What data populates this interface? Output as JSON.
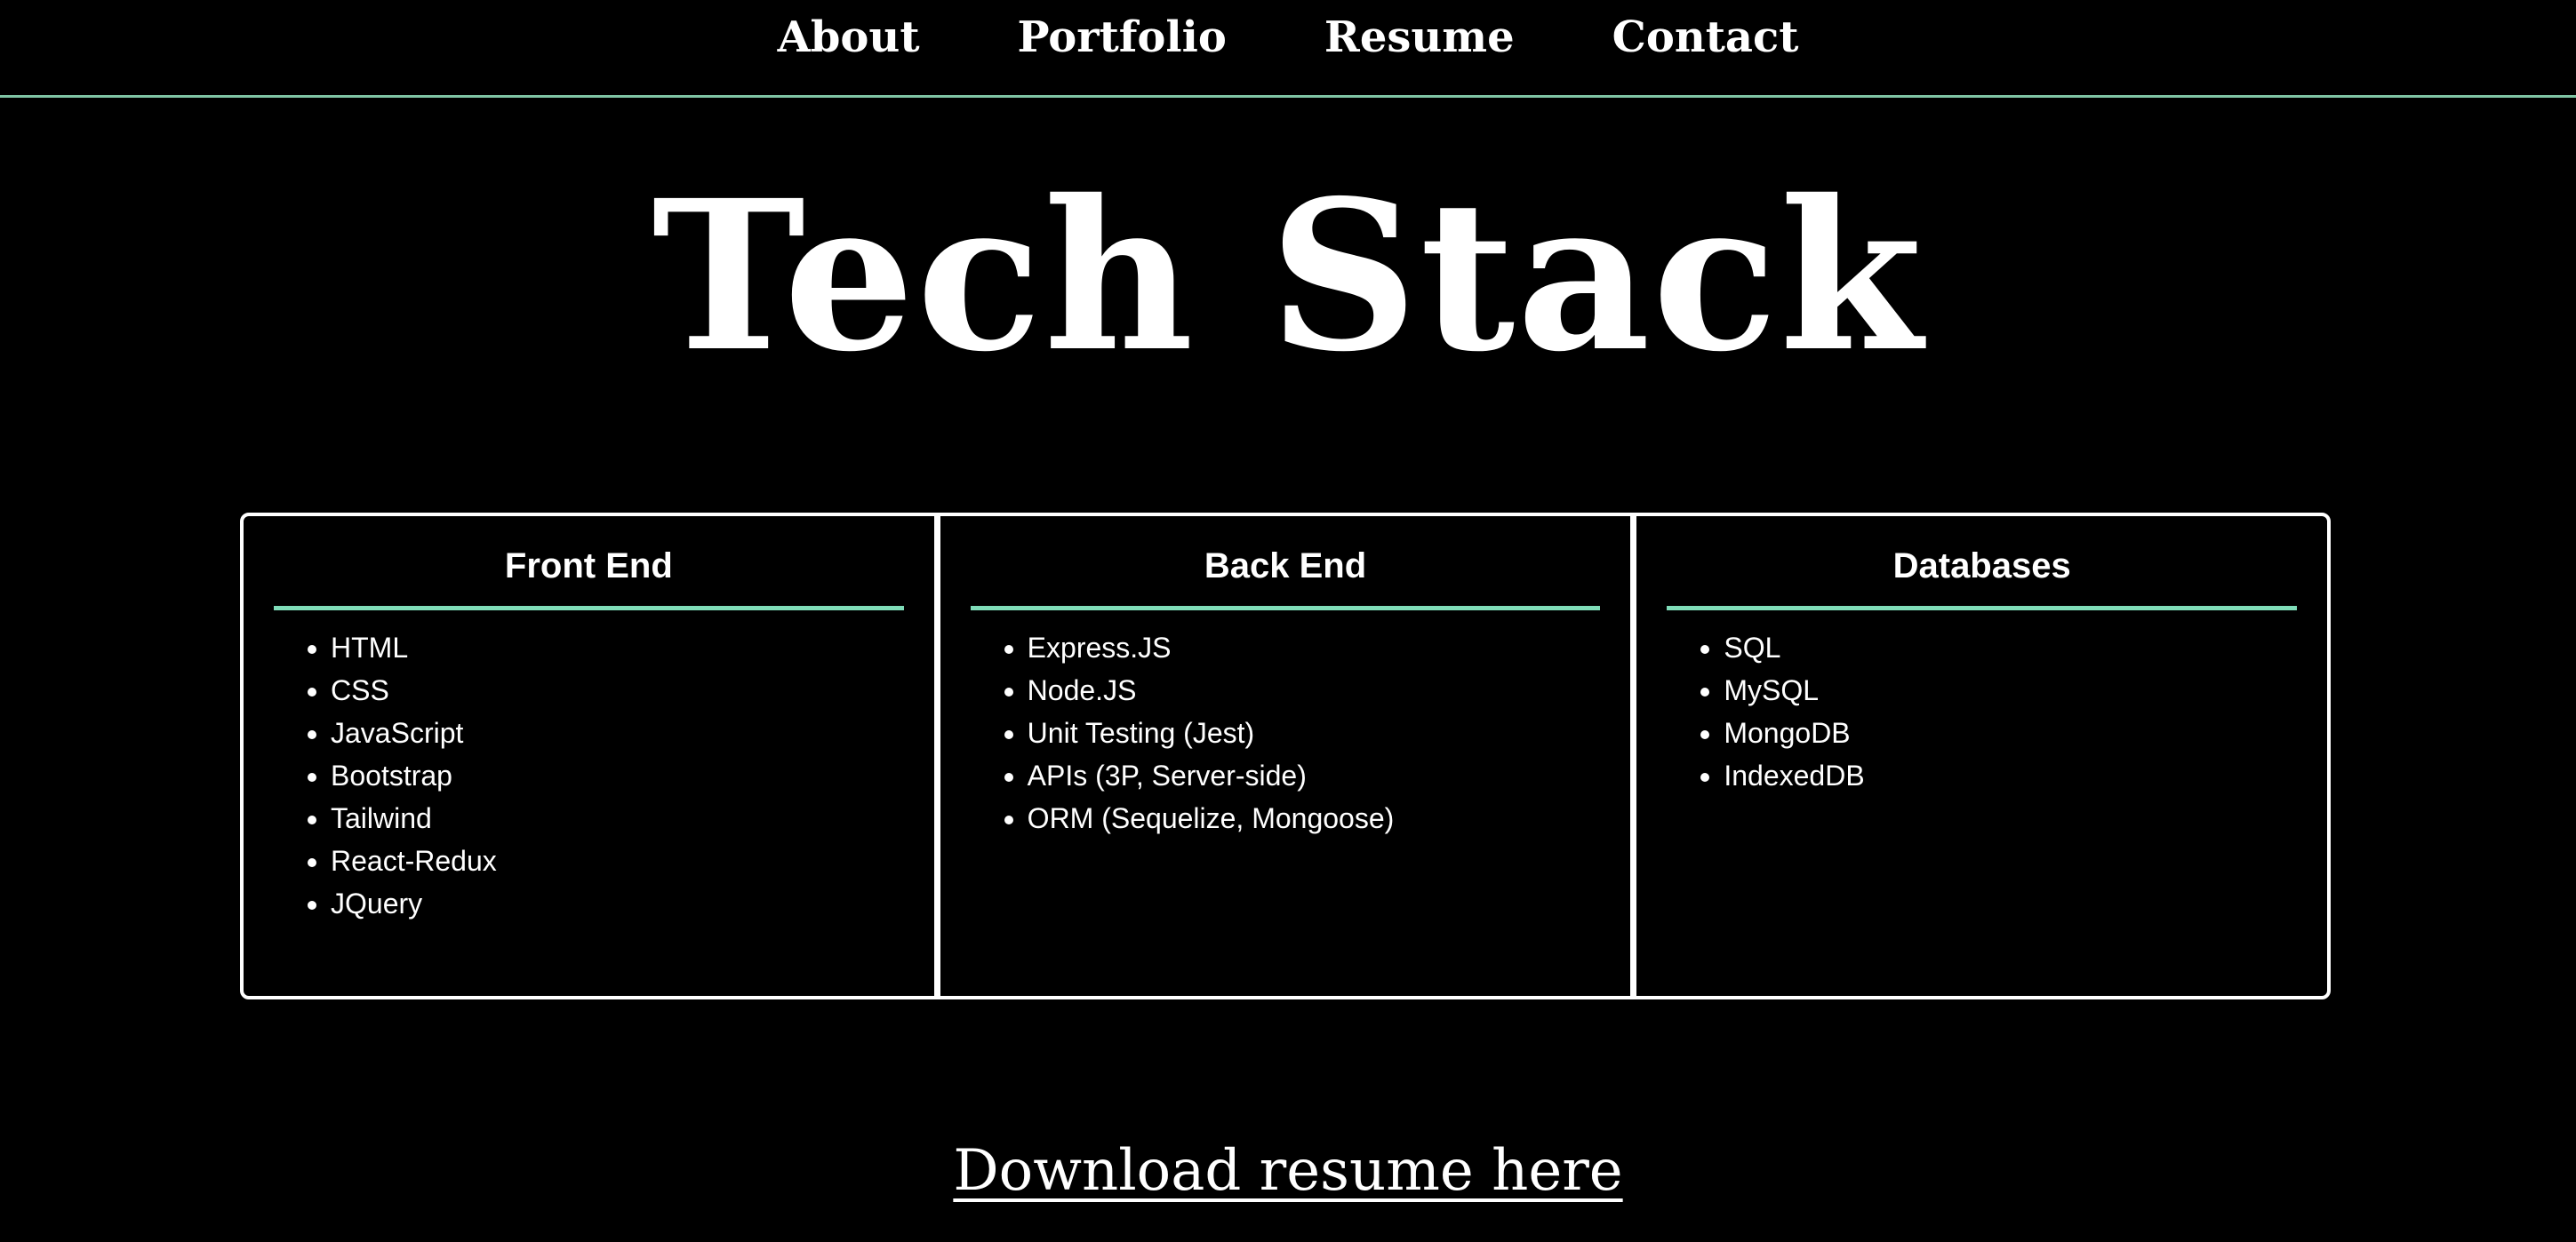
{
  "nav": {
    "items": [
      {
        "label": "About"
      },
      {
        "label": "Portfolio"
      },
      {
        "label": "Resume"
      },
      {
        "label": "Contact"
      }
    ]
  },
  "page": {
    "title": "Tech Stack"
  },
  "stack": {
    "columns": [
      {
        "heading": "Front End",
        "items": [
          "HTML",
          "CSS",
          "JavaScript",
          "Bootstrap",
          "Tailwind",
          "React-Redux",
          "JQuery"
        ]
      },
      {
        "heading": "Back End",
        "items": [
          "Express.JS",
          "Node.JS",
          "Unit Testing (Jest)",
          "APIs (3P, Server-side)",
          "ORM (Sequelize, Mongoose)"
        ]
      },
      {
        "heading": "Databases",
        "items": [
          "SQL",
          "MySQL",
          "MongoDB",
          "IndexedDB"
        ]
      }
    ]
  },
  "download": {
    "label": "Download resume here"
  },
  "colors": {
    "background": "#000000",
    "text": "#ffffff",
    "accent": "#7fdcb8",
    "nav_border": "#7fc4a4"
  }
}
